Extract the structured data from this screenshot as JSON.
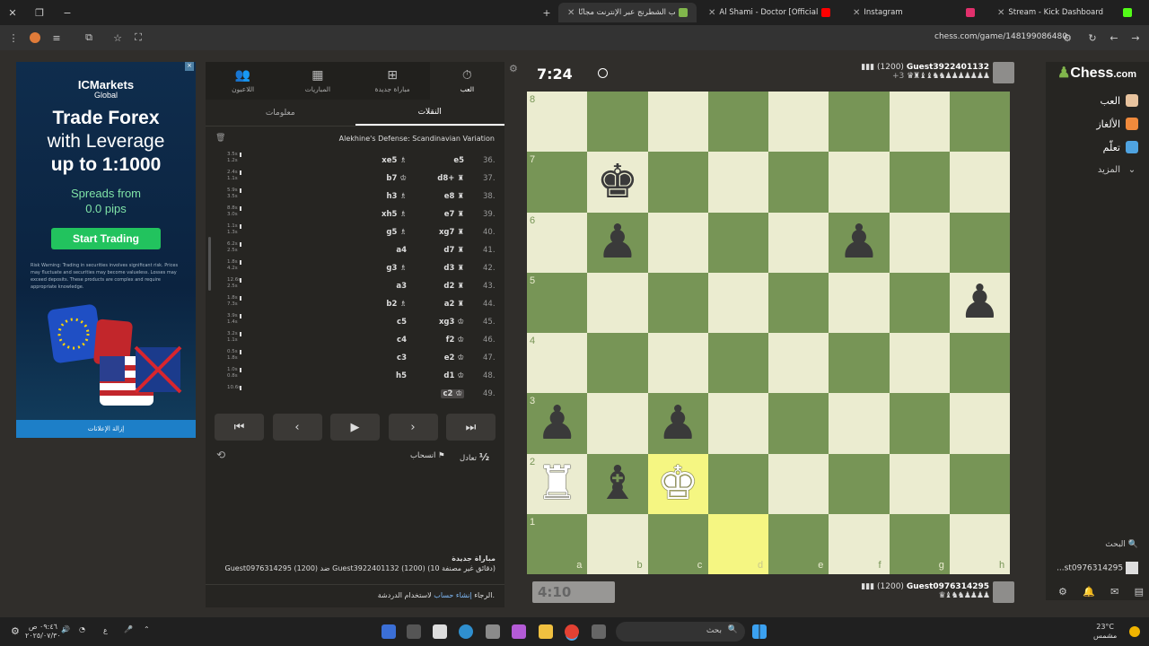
{
  "tabs": [
    {
      "label": "Stream - Kick Dashboard",
      "color": "#53fc18"
    },
    {
      "label": "Instagram",
      "color": "#e1306c"
    },
    {
      "label": "Al Shami - Doctor [Official Music",
      "color": "#ff0000"
    },
    {
      "label": "العب الشطرنج عبر الإنترنت مجانًا",
      "color": "#81b64c"
    }
  ],
  "url": "chess.com/game/148199086480",
  "ad": {
    "brand": "ICMarkets",
    "brand_sub": "Global",
    "line1": "Trade Forex",
    "line2": "with Leverage",
    "line3": "up to 1:1000",
    "spread1": "Spreads from",
    "spread2": "0.0 pips",
    "cta": "Start Trading",
    "risk": "Risk Warning: Trading in securities involves significant risk. Prices may fluctuate and securities may become valueless. Losses may exceed deposits. These products are complex and require appropriate knowledge.",
    "remove": "إزالة الإعلانات"
  },
  "panel": {
    "tabs": [
      {
        "label": "العب",
        "icon": "stopwatch-icon"
      },
      {
        "label": "مباراة جديدة",
        "icon": "plus-icon"
      },
      {
        "label": "المباريات",
        "icon": "board-icon"
      },
      {
        "label": "اللاعبون",
        "icon": "players-icon"
      }
    ],
    "subtabs": [
      "النقلات",
      "معلومات"
    ],
    "opening": "Alekhine's Defense: Scandinavian Variation",
    "moves": [
      {
        "n": "36.",
        "w": "e5",
        "b": "xe5 ♗",
        "t1": "3.5s",
        "t2": "1.2s"
      },
      {
        "n": "37.",
        "w": "d8+ ♜",
        "b": "b7 ♔",
        "t1": "2.4s",
        "t2": "1.1s"
      },
      {
        "n": "38.",
        "w": "e8 ♜",
        "b": "h3 ♗",
        "t1": "5.9s",
        "t2": "3.5s"
      },
      {
        "n": "39.",
        "w": "e7 ♜",
        "b": "xh5 ♗",
        "t1": "8.8s",
        "t2": "3.0s"
      },
      {
        "n": "40.",
        "w": "xg7 ♜",
        "b": "g5 ♗",
        "t1": "1.1s",
        "t2": "1.3s"
      },
      {
        "n": "41.",
        "w": "d7 ♜",
        "b": "a4",
        "t1": "6.2s",
        "t2": "2.5s"
      },
      {
        "n": "42.",
        "w": "d3 ♜",
        "b": "g3 ♗",
        "t1": "1.8s",
        "t2": "4.2s"
      },
      {
        "n": "43.",
        "w": "d2 ♜",
        "b": "a3",
        "t1": "12.6s",
        "t2": "2.5s"
      },
      {
        "n": "44.",
        "w": "a2 ♜",
        "b": "b2 ♗",
        "t1": "1.8s",
        "t2": "7.3s"
      },
      {
        "n": "45.",
        "w": "xg3 ♔",
        "b": "c5",
        "t1": "3.9s",
        "t2": "1.4s"
      },
      {
        "n": "46.",
        "w": "f2 ♔",
        "b": "c4",
        "t1": "3.2s",
        "t2": "1.1s"
      },
      {
        "n": "47.",
        "w": "e2 ♔",
        "b": "c3",
        "t1": "0.5s",
        "t2": "1.8s"
      },
      {
        "n": "48.",
        "w": "d1 ♔",
        "b": "h5",
        "t1": "1.0s",
        "t2": "0.8s"
      },
      {
        "n": "49.",
        "w": "c2 ♔",
        "b": "",
        "t1": "10.6s",
        "t2": ""
      }
    ],
    "actions": {
      "draw": "تعادل",
      "resign": "انسحاب",
      "half": "½"
    },
    "game_title": "مباراة جديدة",
    "game_desc": "Guest0976314295 (1200) ضد Guest3922401132 (1200) (10 دقائق غير مصنفة)",
    "chat_pre": "الرجاء ",
    "chat_link": "إنشاء حساب",
    "chat_post": " لاستخدام الدردشة."
  },
  "clock_top": "7:24",
  "clock_bottom": "4:10",
  "player_top": {
    "name": "Guest3922401132",
    "rating": "(1200)",
    "captured": "♛♜♝♝♞♞♟♟♟♟♟♟♟",
    "adv": "+3"
  },
  "player_bottom": {
    "name": "Guest0976314295",
    "rating": "(1200)",
    "captured": "♛♝♞♞♟♟♟♟"
  },
  "board": {
    "files": [
      "a",
      "b",
      "c",
      "d",
      "e",
      "f",
      "g",
      "h"
    ],
    "ranks": [
      "8",
      "7",
      "6",
      "5",
      "4",
      "3",
      "2",
      "1"
    ],
    "light": "#ebecd0",
    "dark": "#779556",
    "highlight": "#f5f682",
    "pieces": [
      {
        "sq": "b7",
        "glyph": "♚",
        "color": "black"
      },
      {
        "sq": "b6",
        "glyph": "♟",
        "color": "black"
      },
      {
        "sq": "f6",
        "glyph": "♟",
        "color": "black"
      },
      {
        "sq": "h5",
        "glyph": "♟",
        "color": "black"
      },
      {
        "sq": "a3",
        "glyph": "♟",
        "color": "black"
      },
      {
        "sq": "c3",
        "glyph": "♟",
        "color": "black"
      },
      {
        "sq": "b2",
        "glyph": "♝",
        "color": "black"
      },
      {
        "sq": "a2",
        "glyph": "♜",
        "color": "white"
      },
      {
        "sq": "c2",
        "glyph": "♚",
        "color": "white"
      }
    ],
    "highlighted": [
      "c2",
      "d1"
    ]
  },
  "right": {
    "logo": "Chess",
    "logo_suffix": ".com",
    "items": [
      {
        "label": "العب",
        "color": "#e8c39e"
      },
      {
        "label": "الألغاز",
        "color": "#f08a3c"
      },
      {
        "label": "تعلّم",
        "color": "#4fa3e0"
      },
      {
        "label": "المزيد",
        "color": ""
      }
    ],
    "search": "البحث",
    "user": "...st0976314295"
  },
  "taskbar": {
    "search": "بحث",
    "temp": "23°C",
    "weather": "مشمس",
    "time": "٠٩:٤٦ ص",
    "date": "٢٠٢٥/٠٧/٣٠",
    "lang": "ع"
  }
}
